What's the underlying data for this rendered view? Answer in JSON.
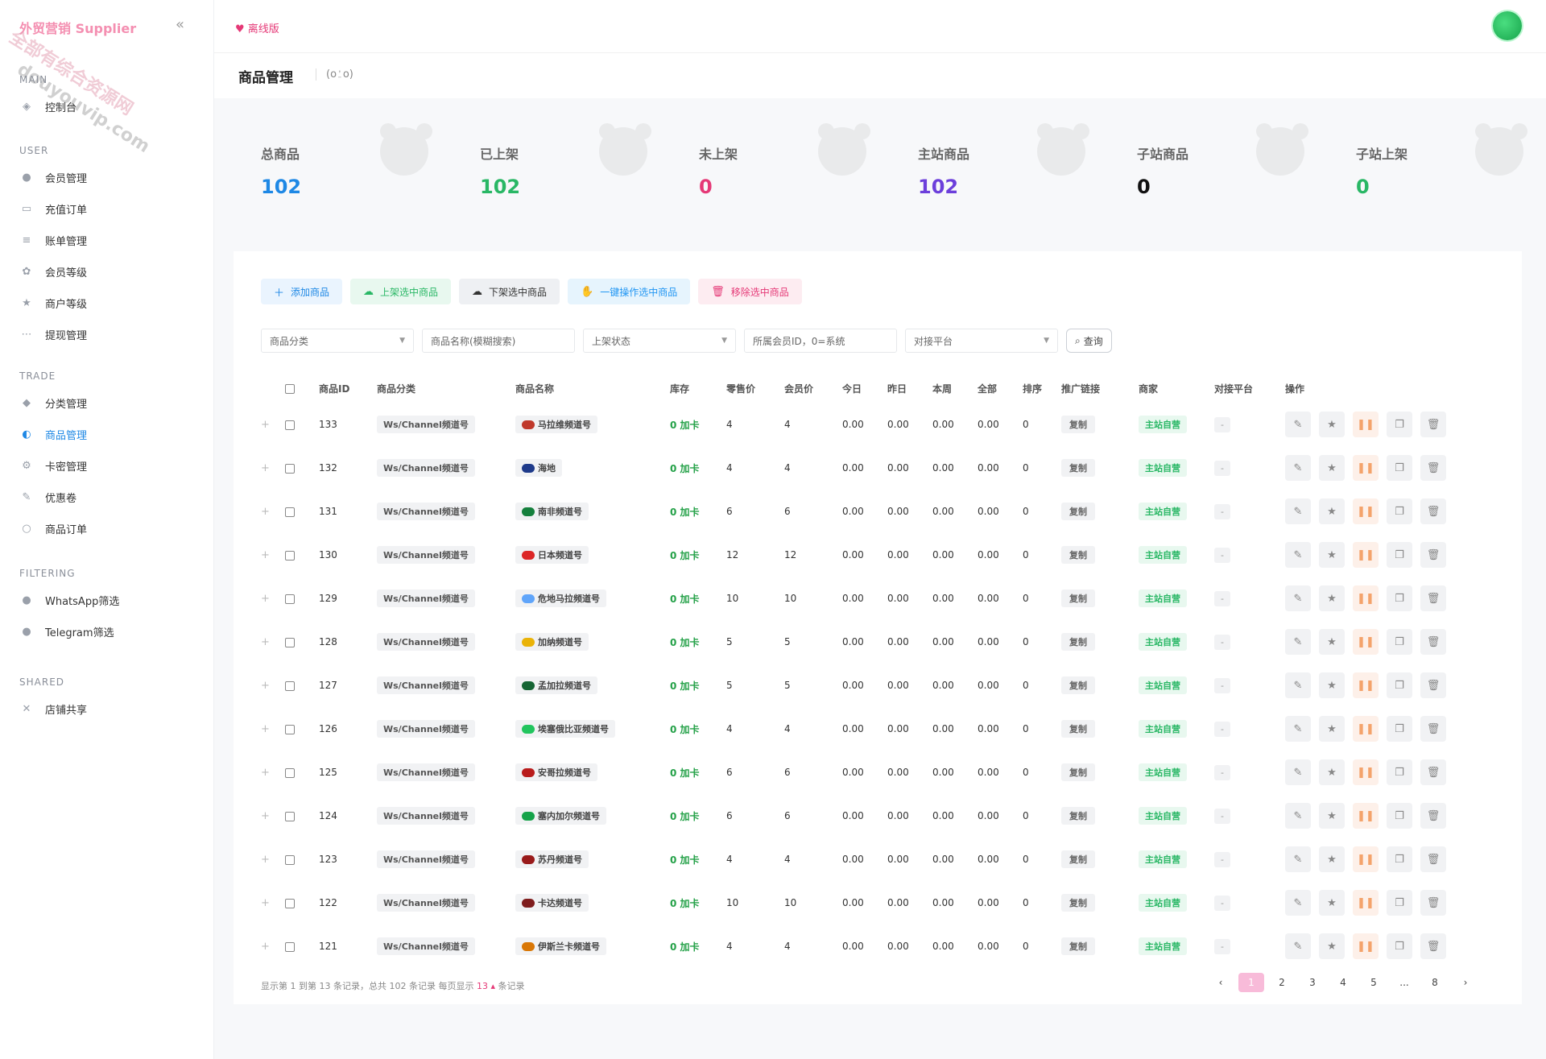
{
  "brand": "外贸营销 Supplier",
  "watermark": "全部有综合资源网 douyouvip.com",
  "sidebar": {
    "sections": [
      {
        "title": "MAIN",
        "items": [
          {
            "label": "控制台",
            "icon": "dashboard-icon"
          }
        ]
      },
      {
        "title": "USER",
        "items": [
          {
            "label": "会员管理",
            "icon": "user-icon"
          },
          {
            "label": "充值订单",
            "icon": "card-icon"
          },
          {
            "label": "账单管理",
            "icon": "bill-icon"
          },
          {
            "label": "会员等级",
            "icon": "level-icon"
          },
          {
            "label": "商户等级",
            "icon": "merchant-icon"
          },
          {
            "label": "提现管理",
            "icon": "withdraw-icon"
          }
        ]
      },
      {
        "title": "TRADE",
        "items": [
          {
            "label": "分类管理",
            "icon": "category-icon"
          },
          {
            "label": "商品管理",
            "icon": "goods-icon",
            "active": true
          },
          {
            "label": "卡密管理",
            "icon": "key-icon"
          },
          {
            "label": "优惠卷",
            "icon": "coupon-icon"
          },
          {
            "label": "商品订单",
            "icon": "order-icon"
          }
        ]
      },
      {
        "title": "FILTERING",
        "items": [
          {
            "label": "WhatsApp筛选",
            "icon": "whatsapp-icon"
          },
          {
            "label": "Telegram筛选",
            "icon": "telegram-icon"
          }
        ]
      },
      {
        "title": "SHARED",
        "items": [
          {
            "label": "店铺共享",
            "icon": "share-icon"
          }
        ]
      }
    ]
  },
  "topbar": {
    "offline_label": "离线版"
  },
  "page": {
    "title": "商品管理",
    "face": "(o⍘o)"
  },
  "stats": [
    {
      "label": "总商品",
      "value": "102",
      "color": "#1e88e5"
    },
    {
      "label": "已上架",
      "value": "102",
      "color": "#29b765"
    },
    {
      "label": "未上架",
      "value": "0",
      "color": "#e53977"
    },
    {
      "label": "主站商品",
      "value": "102",
      "color": "#6c3fdb"
    },
    {
      "label": "子站商品",
      "value": "0",
      "color": "#111111"
    },
    {
      "label": "子站上架",
      "value": "0",
      "color": "#29b765"
    }
  ],
  "toolbar": {
    "add": "添加商品",
    "up": "上架选中商品",
    "down": "下架选中商品",
    "one": "一键操作选中商品",
    "del": "移除选中商品"
  },
  "filters": {
    "category": "商品分类",
    "name": "商品名称(模糊搜索)",
    "status": "上架状态",
    "member": "所属会员ID，0=系统",
    "platform": "对接平台",
    "query": "查询"
  },
  "table": {
    "headers": [
      "商品ID",
      "商品分类",
      "商品名称",
      "库存",
      "零售价",
      "会员价",
      "今日",
      "昨日",
      "本周",
      "全部",
      "排序",
      "推广链接",
      "商家",
      "对接平台",
      "操作"
    ],
    "rows": [
      {
        "id": "133",
        "cat": "Ws/Channel频道号",
        "name": "马拉维频道号",
        "flag": "#c0392b",
        "stock": "0 加卡",
        "retail": "4",
        "member": "4",
        "today": "0.00",
        "yest": "0.00",
        "week": "0.00",
        "all": "0.00",
        "sort": "0",
        "link": "复制",
        "shop": "主站自营",
        "plat": "-"
      },
      {
        "id": "132",
        "cat": "Ws/Channel频道号",
        "name": "海地",
        "flag": "#1e3a8a",
        "stock": "0 加卡",
        "retail": "4",
        "member": "4",
        "today": "0.00",
        "yest": "0.00",
        "week": "0.00",
        "all": "0.00",
        "sort": "0",
        "link": "复制",
        "shop": "主站自营",
        "plat": "-"
      },
      {
        "id": "131",
        "cat": "Ws/Channel频道号",
        "name": "南非频道号",
        "flag": "#15803d",
        "stock": "0 加卡",
        "retail": "6",
        "member": "6",
        "today": "0.00",
        "yest": "0.00",
        "week": "0.00",
        "all": "0.00",
        "sort": "0",
        "link": "复制",
        "shop": "主站自营",
        "plat": "-"
      },
      {
        "id": "130",
        "cat": "Ws/Channel频道号",
        "name": "日本频道号",
        "flag": "#dc2626",
        "stock": "0 加卡",
        "retail": "12",
        "member": "12",
        "today": "0.00",
        "yest": "0.00",
        "week": "0.00",
        "all": "0.00",
        "sort": "0",
        "link": "复制",
        "shop": "主站自营",
        "plat": "-"
      },
      {
        "id": "129",
        "cat": "Ws/Channel频道号",
        "name": "危地马拉频道号",
        "flag": "#60a5fa",
        "stock": "0 加卡",
        "retail": "10",
        "member": "10",
        "today": "0.00",
        "yest": "0.00",
        "week": "0.00",
        "all": "0.00",
        "sort": "0",
        "link": "复制",
        "shop": "主站自营",
        "plat": "-"
      },
      {
        "id": "128",
        "cat": "Ws/Channel频道号",
        "name": "加纳频道号",
        "flag": "#eab308",
        "stock": "0 加卡",
        "retail": "5",
        "member": "5",
        "today": "0.00",
        "yest": "0.00",
        "week": "0.00",
        "all": "0.00",
        "sort": "0",
        "link": "复制",
        "shop": "主站自营",
        "plat": "-"
      },
      {
        "id": "127",
        "cat": "Ws/Channel频道号",
        "name": "孟加拉频道号",
        "flag": "#166534",
        "stock": "0 加卡",
        "retail": "5",
        "member": "5",
        "today": "0.00",
        "yest": "0.00",
        "week": "0.00",
        "all": "0.00",
        "sort": "0",
        "link": "复制",
        "shop": "主站自营",
        "plat": "-"
      },
      {
        "id": "126",
        "cat": "Ws/Channel频道号",
        "name": "埃塞俄比亚频道号",
        "flag": "#22c55e",
        "stock": "0 加卡",
        "retail": "4",
        "member": "4",
        "today": "0.00",
        "yest": "0.00",
        "week": "0.00",
        "all": "0.00",
        "sort": "0",
        "link": "复制",
        "shop": "主站自营",
        "plat": "-"
      },
      {
        "id": "125",
        "cat": "Ws/Channel频道号",
        "name": "安哥拉频道号",
        "flag": "#b91c1c",
        "stock": "0 加卡",
        "retail": "6",
        "member": "6",
        "today": "0.00",
        "yest": "0.00",
        "week": "0.00",
        "all": "0.00",
        "sort": "0",
        "link": "复制",
        "shop": "主站自营",
        "plat": "-"
      },
      {
        "id": "124",
        "cat": "Ws/Channel频道号",
        "name": "塞内加尔频道号",
        "flag": "#16a34a",
        "stock": "0 加卡",
        "retail": "6",
        "member": "6",
        "today": "0.00",
        "yest": "0.00",
        "week": "0.00",
        "all": "0.00",
        "sort": "0",
        "link": "复制",
        "shop": "主站自营",
        "plat": "-"
      },
      {
        "id": "123",
        "cat": "Ws/Channel频道号",
        "name": "苏丹频道号",
        "flag": "#991b1b",
        "stock": "0 加卡",
        "retail": "4",
        "member": "4",
        "today": "0.00",
        "yest": "0.00",
        "week": "0.00",
        "all": "0.00",
        "sort": "0",
        "link": "复制",
        "shop": "主站自营",
        "plat": "-"
      },
      {
        "id": "122",
        "cat": "Ws/Channel频道号",
        "name": "卡达频道号",
        "flag": "#7f1d1d",
        "stock": "0 加卡",
        "retail": "10",
        "member": "10",
        "today": "0.00",
        "yest": "0.00",
        "week": "0.00",
        "all": "0.00",
        "sort": "0",
        "link": "复制",
        "shop": "主站自营",
        "plat": "-"
      },
      {
        "id": "121",
        "cat": "Ws/Channel频道号",
        "name": "伊斯兰卡频道号",
        "flag": "#d97706",
        "stock": "0 加卡",
        "retail": "4",
        "member": "4",
        "today": "0.00",
        "yest": "0.00",
        "week": "0.00",
        "all": "0.00",
        "sort": "0",
        "link": "复制",
        "shop": "主站自营",
        "plat": "-"
      }
    ]
  },
  "footer": {
    "info_before": "显示第 1 到第 13 条记录，总共 102 条记录  每页显示",
    "page_size": "13",
    "info_after": "条记录"
  },
  "pager": {
    "prev": "‹",
    "pages": [
      "1",
      "2",
      "3",
      "4",
      "5",
      "...",
      "8"
    ],
    "next": "›"
  }
}
